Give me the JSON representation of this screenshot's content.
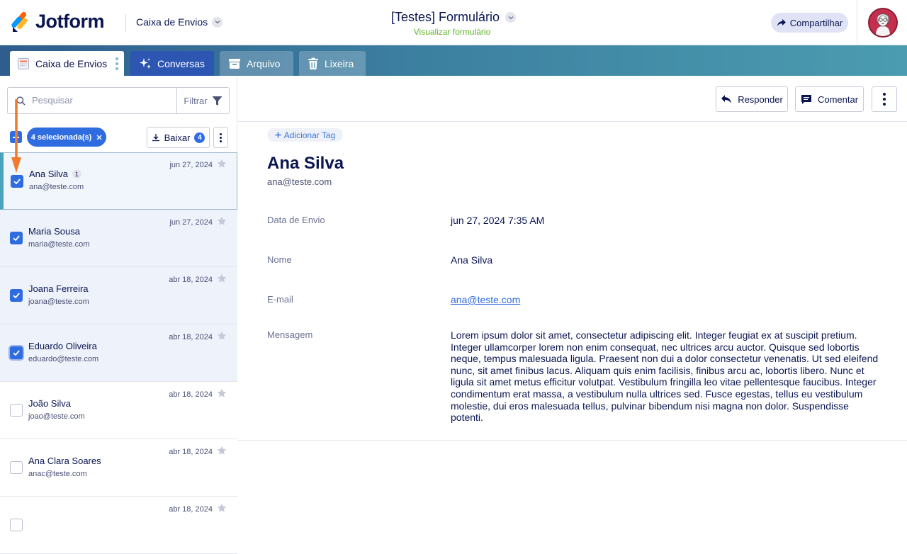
{
  "brand": {
    "name": "Jotform"
  },
  "header": {
    "inbox_switch": "Caixa de Envios",
    "form_title": "[Testes] Formulário",
    "form_preview": "Visualizar formulário",
    "share_label": "Compartilhar"
  },
  "tabs": [
    {
      "label": "Caixa de Envios",
      "active": true
    },
    {
      "label": "Conversas"
    },
    {
      "label": "Arquivo"
    },
    {
      "label": "Lixeira"
    }
  ],
  "search": {
    "placeholder": "Pesquisar",
    "filter_label": "Filtrar"
  },
  "bulk": {
    "selected_label": "4 selecionada(s)",
    "download_label": "Baixar",
    "download_count": "4"
  },
  "submissions": [
    {
      "name": "Ana Silva",
      "count": "1",
      "email": "ana@teste.com",
      "date": "jun 27, 2024",
      "checked": true,
      "active": true
    },
    {
      "name": "Maria Sousa",
      "email": "maria@teste.com",
      "date": "jun 27, 2024",
      "checked": true
    },
    {
      "name": "Joana Ferreira",
      "email": "joana@teste.com",
      "date": "abr 18, 2024",
      "checked": true
    },
    {
      "name": "Eduardo Oliveira",
      "email": "eduardo@teste.com",
      "date": "abr 18, 2024",
      "checked": true
    },
    {
      "name": "João Silva",
      "email": "joao@teste.com",
      "date": "abr 18, 2024",
      "checked": false
    },
    {
      "name": "Ana Clara Soares",
      "email": "anac@teste.com",
      "date": "abr 18, 2024",
      "checked": false
    },
    {
      "name": "",
      "email": "",
      "date": "abr 18, 2024",
      "checked": false
    }
  ],
  "actions": {
    "reply_label": "Responder",
    "comment_label": "Comentar"
  },
  "detail": {
    "add_tag_label": "Adicionar Tag",
    "name": "Ana Silva",
    "email": "ana@teste.com",
    "fields": [
      {
        "label": "Data de Envio",
        "value": "jun 27, 2024 7:35 AM"
      },
      {
        "label": "Nome",
        "value": "Ana Silva"
      },
      {
        "label": "E-mail",
        "value": "ana@teste.com"
      },
      {
        "label": "Mensagem",
        "value": "Lorem ipsum dolor sit amet, consectetur adipiscing elit. Integer feugiat ex at suscipit pretium. Integer ullamcorper lorem non enim consequat, nec ultrices arcu auctor. Quisque sed lobortis neque, tempus malesuada ligula. Praesent non dui a dolor consectetur venenatis. Ut sed eleifend nunc, sit amet finibus lacus. Aliquam quis enim facilisis, finibus arcu ac, lobortis libero. Nunc et ligula sit amet metus efficitur volutpat. Vestibulum fringilla leo vitae pellentesque faucibus. Integer condimentum erat massa, a vestibulum nulla ultrices sed. Fusce egestas, tellus eu vestibulum molestie, dui eros malesuada tellus, pulvinar bibendum nisi magna non dolor. Suspendisse potenti."
      }
    ]
  },
  "colors": {
    "accent": "#2f6ce0",
    "annotation_arrow": "#f07b2c",
    "preview_link": "#64b22b"
  }
}
